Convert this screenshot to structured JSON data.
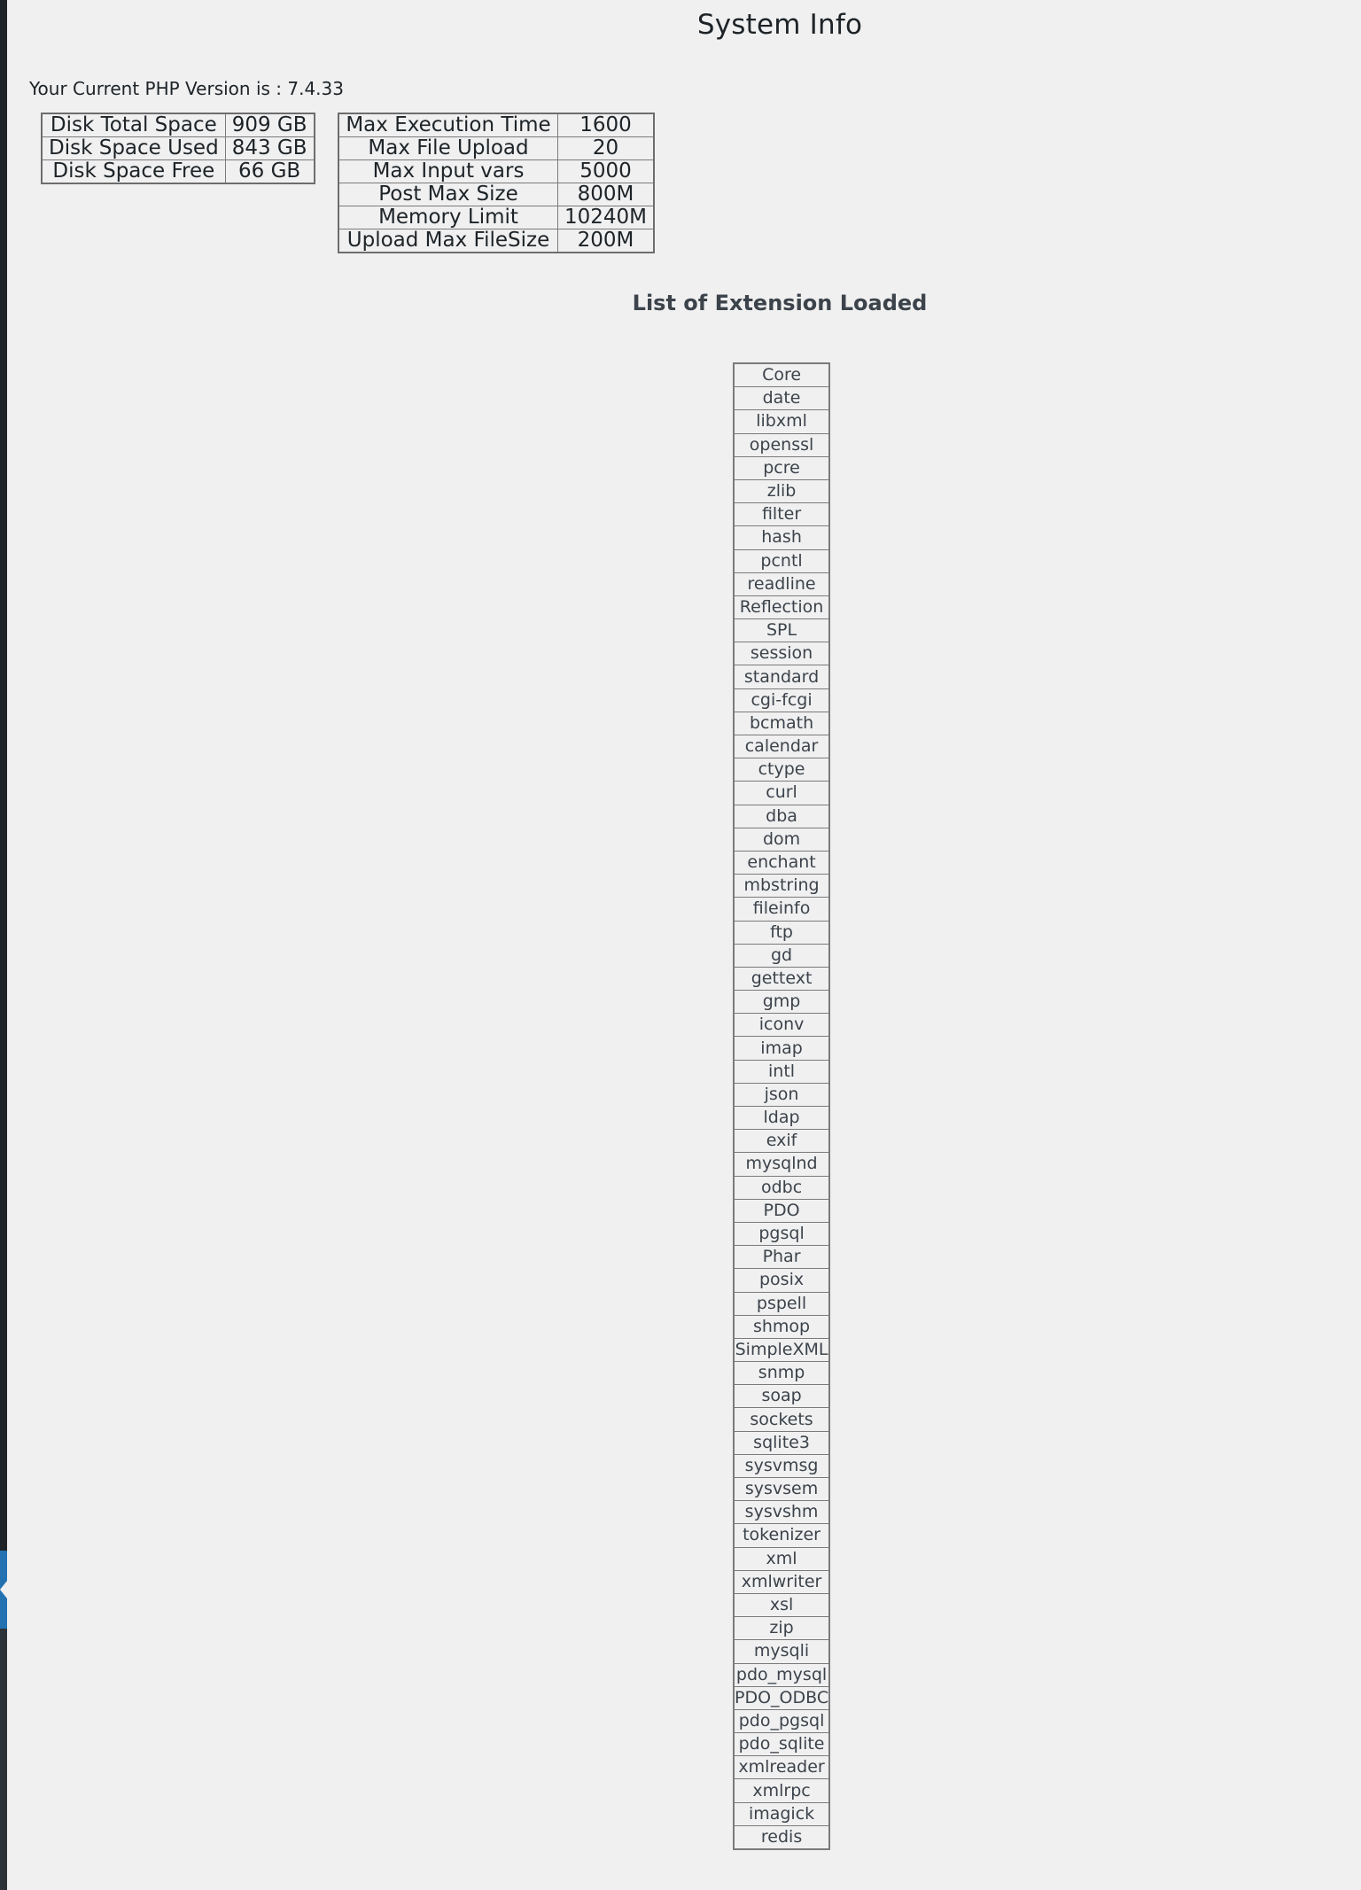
{
  "admin_sidebar": {
    "collapse_arrow_icon": "arrow-left-icon",
    "accent_color": "#2271b1",
    "background_color": "#1d2327"
  },
  "header": {
    "title": "System Info"
  },
  "php": {
    "version_line": "Your Current PHP Version is : 7.4.33"
  },
  "disk_table": {
    "rows": [
      {
        "label": "Disk Total Space",
        "value": "909 GB"
      },
      {
        "label": "Disk Space Used",
        "value": "843 GB"
      },
      {
        "label": "Disk Space Free",
        "value": "66 GB"
      }
    ]
  },
  "php_settings_table": {
    "rows": [
      {
        "label": "Max Execution Time",
        "value": "1600"
      },
      {
        "label": "Max File Upload",
        "value": "20"
      },
      {
        "label": "Max Input vars",
        "value": "5000"
      },
      {
        "label": "Post Max Size",
        "value": "800M"
      },
      {
        "label": "Memory Limit",
        "value": "10240M"
      },
      {
        "label": "Upload Max FileSize",
        "value": "200M"
      }
    ]
  },
  "extensions": {
    "title": "List of Extension Loaded",
    "items": [
      "Core",
      "date",
      "libxml",
      "openssl",
      "pcre",
      "zlib",
      "filter",
      "hash",
      "pcntl",
      "readline",
      "Reflection",
      "SPL",
      "session",
      "standard",
      "cgi-fcgi",
      "bcmath",
      "calendar",
      "ctype",
      "curl",
      "dba",
      "dom",
      "enchant",
      "mbstring",
      "fileinfo",
      "ftp",
      "gd",
      "gettext",
      "gmp",
      "iconv",
      "imap",
      "intl",
      "json",
      "ldap",
      "exif",
      "mysqlnd",
      "odbc",
      "PDO",
      "pgsql",
      "Phar",
      "posix",
      "pspell",
      "shmop",
      "SimpleXML",
      "snmp",
      "soap",
      "sockets",
      "sqlite3",
      "sysvmsg",
      "sysvsem",
      "sysvshm",
      "tokenizer",
      "xml",
      "xmlwriter",
      "xsl",
      "zip",
      "mysqli",
      "pdo_mysql",
      "PDO_ODBC",
      "pdo_pgsql",
      "pdo_sqlite",
      "xmlreader",
      "xmlrpc",
      "imagick",
      "redis"
    ]
  }
}
